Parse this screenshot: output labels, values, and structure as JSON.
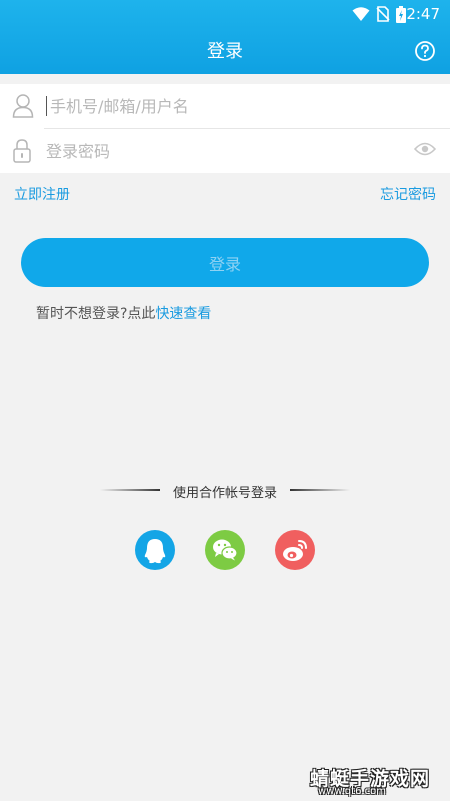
{
  "status_bar": {
    "time": "2:47",
    "icons": [
      "wifi-icon",
      "no-sim-icon",
      "battery-icon"
    ]
  },
  "header": {
    "title": "登录",
    "help_icon": "help-circle-icon"
  },
  "form": {
    "account_placeholder": "手机号/邮箱/用户名",
    "account_value": "",
    "password_placeholder": "登录密码",
    "password_value": "",
    "icons": [
      "user-icon",
      "lock-icon",
      "eye-icon"
    ]
  },
  "links": {
    "register": "立即注册",
    "forgot_password": "忘记密码"
  },
  "login_button": {
    "label": "登录"
  },
  "quick_view": {
    "prefix": "暂时不想登录?点此",
    "link": "快速查看"
  },
  "third_party": {
    "label": "使用合作帐号登录",
    "providers": [
      "qq-icon",
      "wechat-icon",
      "weibo-icon"
    ]
  },
  "colors": {
    "primary": "#10a8ea",
    "link": "#1a9be0",
    "qq": "#14a5e6",
    "wechat": "#7dcb43",
    "weibo": "#f05f5f"
  },
  "watermark": {
    "text": "蜻蜓手游戏网",
    "url": "www.qt6.com"
  }
}
